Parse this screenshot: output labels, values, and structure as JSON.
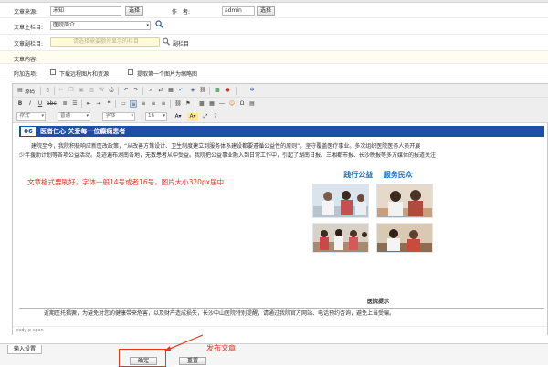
{
  "form": {
    "source_label": "文章来源:",
    "source_value": "未知",
    "source_btn": "选择",
    "author_label": "作　者:",
    "author_value": "admin",
    "author_btn": "选择",
    "column_label": "文章主栏目:",
    "column_value": "医院简介",
    "subcolumn_label": "文章副栏目:",
    "subcolumn_placeholder": "请选择需要额外显示的栏目",
    "subcolumn_btn": "副栏目",
    "content_label": "文章内容:",
    "attach_label": "附加选项:",
    "opt_download": "下载远程图片和资源",
    "opt_thumb": "提取第一个图片为缩略图"
  },
  "toolbar": {
    "source": "源码",
    "style": "样式",
    "format": "普通",
    "font": "字体",
    "size": "16"
  },
  "article": {
    "number": "06",
    "title": "医者仁心 关爱每一位癫痫患者",
    "para1": "建院至今，我院积极响应新医改政策，“从改善方策设计、卫生制度建立到服务体系建设都要遵循公益性的原则”。坚守覆盖医疗事业。多次组织医院医务人员开展",
    "para2": "少年援助计划等各项公益活动。足迹遍布湖南各地，无数患者从中受益。我院把公益事业融入到日常工作中，引起了湖南日报、三湘都市报、长沙晚报等多方媒体的报道关注",
    "hint": "文章格式要刷好，字体一般14号或者16号，图片大小320px居中",
    "banner_left": "践行公益",
    "banner_right": "服务民众",
    "tip_title": "医院提示",
    "tip_text": "近期医托猖獗，为避免对您的健康带来危害，以及财产造成损失，长沙中山医院特别提醒，请通过我院官方网站、电话预约咨询，避免上当受骗。"
  },
  "status_path": "body p span",
  "tabs": {
    "input_settings": "输入设置"
  },
  "actions": {
    "confirm": "确定",
    "reset": "重置"
  },
  "annotation": "发布文章",
  "colors": {
    "accent_blue": "#1d4fa6",
    "hint_red": "#e8341f",
    "banner_blue": "#1a6fc4"
  },
  "icons": [
    "source-icon",
    "undo-icon",
    "redo-icon",
    "bold-icon",
    "italic-icon",
    "underline-icon",
    "align-left-icon",
    "table-icon",
    "image-icon",
    "link-icon",
    "magnifier-icon",
    "folder-icon",
    "arrow-icon"
  ]
}
